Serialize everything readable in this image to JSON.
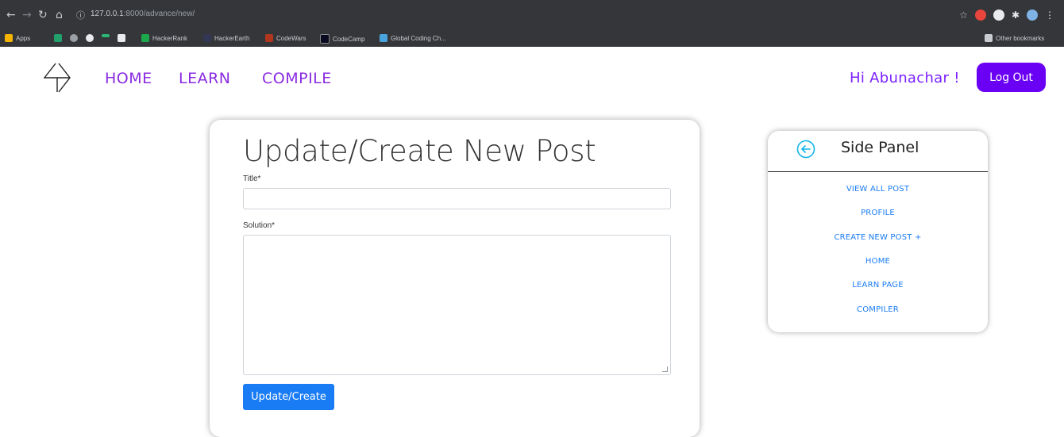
{
  "browser": {
    "url_host": "127.0.0.1",
    "url_rest": ":8000/advance/new/",
    "bookmarks": [
      {
        "label": "Apps",
        "color": "#f4b400"
      },
      {
        "label": "",
        "color": "#22a06b"
      },
      {
        "label": "",
        "color": "#9aa0a6"
      },
      {
        "label": "",
        "color": "#e8eaed"
      },
      {
        "label": "",
        "color": "#2bb673"
      },
      {
        "label": "",
        "color": "#e8eaed"
      },
      {
        "label": "HackerRank",
        "color": "#1ba94c"
      },
      {
        "label": "HackerEarth",
        "color": "#323754"
      },
      {
        "label": "CodeWars",
        "color": "#b1361e"
      },
      {
        "label": "CodeCamp",
        "color": "#0a0a23"
      },
      {
        "label": "Global Coding Ch...",
        "color": "#4aa3df"
      }
    ],
    "other_bookmarks": "Other bookmarks"
  },
  "nav": {
    "home": "HOME",
    "learn": "LEARN",
    "compile": "COMPILE",
    "greeting": "Hi Abunachar !",
    "logout": "Log Out",
    "accent": "#8a2be2"
  },
  "form": {
    "title": "Update/Create New Post",
    "title_label": "Title*",
    "title_value": "",
    "solution_label": "Solution*",
    "solution_value": "",
    "submit": "Update/Create"
  },
  "side_panel": {
    "title": "Side Panel",
    "back_icon": "arrow-left-circle-icon",
    "links": [
      "VIEW ALL POST",
      "PROFILE",
      "CREATE NEW POST +",
      "HOME",
      "LEARN PAGE",
      "COMPILER"
    ]
  }
}
